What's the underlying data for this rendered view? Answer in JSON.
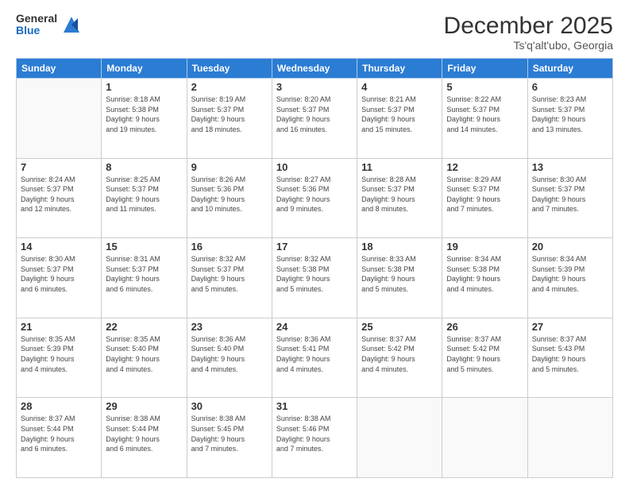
{
  "logo": {
    "general": "General",
    "blue": "Blue"
  },
  "header": {
    "month": "December 2025",
    "location": "Ts'q'alt'ubo, Georgia"
  },
  "days_of_week": [
    "Sunday",
    "Monday",
    "Tuesday",
    "Wednesday",
    "Thursday",
    "Friday",
    "Saturday"
  ],
  "weeks": [
    [
      {
        "day": "",
        "info": ""
      },
      {
        "day": "1",
        "info": "Sunrise: 8:18 AM\nSunset: 5:38 PM\nDaylight: 9 hours\nand 19 minutes."
      },
      {
        "day": "2",
        "info": "Sunrise: 8:19 AM\nSunset: 5:37 PM\nDaylight: 9 hours\nand 18 minutes."
      },
      {
        "day": "3",
        "info": "Sunrise: 8:20 AM\nSunset: 5:37 PM\nDaylight: 9 hours\nand 16 minutes."
      },
      {
        "day": "4",
        "info": "Sunrise: 8:21 AM\nSunset: 5:37 PM\nDaylight: 9 hours\nand 15 minutes."
      },
      {
        "day": "5",
        "info": "Sunrise: 8:22 AM\nSunset: 5:37 PM\nDaylight: 9 hours\nand 14 minutes."
      },
      {
        "day": "6",
        "info": "Sunrise: 8:23 AM\nSunset: 5:37 PM\nDaylight: 9 hours\nand 13 minutes."
      }
    ],
    [
      {
        "day": "7",
        "info": "Sunrise: 8:24 AM\nSunset: 5:37 PM\nDaylight: 9 hours\nand 12 minutes."
      },
      {
        "day": "8",
        "info": "Sunrise: 8:25 AM\nSunset: 5:37 PM\nDaylight: 9 hours\nand 11 minutes."
      },
      {
        "day": "9",
        "info": "Sunrise: 8:26 AM\nSunset: 5:36 PM\nDaylight: 9 hours\nand 10 minutes."
      },
      {
        "day": "10",
        "info": "Sunrise: 8:27 AM\nSunset: 5:36 PM\nDaylight: 9 hours\nand 9 minutes."
      },
      {
        "day": "11",
        "info": "Sunrise: 8:28 AM\nSunset: 5:37 PM\nDaylight: 9 hours\nand 8 minutes."
      },
      {
        "day": "12",
        "info": "Sunrise: 8:29 AM\nSunset: 5:37 PM\nDaylight: 9 hours\nand 7 minutes."
      },
      {
        "day": "13",
        "info": "Sunrise: 8:30 AM\nSunset: 5:37 PM\nDaylight: 9 hours\nand 7 minutes."
      }
    ],
    [
      {
        "day": "14",
        "info": "Sunrise: 8:30 AM\nSunset: 5:37 PM\nDaylight: 9 hours\nand 6 minutes."
      },
      {
        "day": "15",
        "info": "Sunrise: 8:31 AM\nSunset: 5:37 PM\nDaylight: 9 hours\nand 6 minutes."
      },
      {
        "day": "16",
        "info": "Sunrise: 8:32 AM\nSunset: 5:37 PM\nDaylight: 9 hours\nand 5 minutes."
      },
      {
        "day": "17",
        "info": "Sunrise: 8:32 AM\nSunset: 5:38 PM\nDaylight: 9 hours\nand 5 minutes."
      },
      {
        "day": "18",
        "info": "Sunrise: 8:33 AM\nSunset: 5:38 PM\nDaylight: 9 hours\nand 5 minutes."
      },
      {
        "day": "19",
        "info": "Sunrise: 8:34 AM\nSunset: 5:38 PM\nDaylight: 9 hours\nand 4 minutes."
      },
      {
        "day": "20",
        "info": "Sunrise: 8:34 AM\nSunset: 5:39 PM\nDaylight: 9 hours\nand 4 minutes."
      }
    ],
    [
      {
        "day": "21",
        "info": "Sunrise: 8:35 AM\nSunset: 5:39 PM\nDaylight: 9 hours\nand 4 minutes."
      },
      {
        "day": "22",
        "info": "Sunrise: 8:35 AM\nSunset: 5:40 PM\nDaylight: 9 hours\nand 4 minutes."
      },
      {
        "day": "23",
        "info": "Sunrise: 8:36 AM\nSunset: 5:40 PM\nDaylight: 9 hours\nand 4 minutes."
      },
      {
        "day": "24",
        "info": "Sunrise: 8:36 AM\nSunset: 5:41 PM\nDaylight: 9 hours\nand 4 minutes."
      },
      {
        "day": "25",
        "info": "Sunrise: 8:37 AM\nSunset: 5:42 PM\nDaylight: 9 hours\nand 4 minutes."
      },
      {
        "day": "26",
        "info": "Sunrise: 8:37 AM\nSunset: 5:42 PM\nDaylight: 9 hours\nand 5 minutes."
      },
      {
        "day": "27",
        "info": "Sunrise: 8:37 AM\nSunset: 5:43 PM\nDaylight: 9 hours\nand 5 minutes."
      }
    ],
    [
      {
        "day": "28",
        "info": "Sunrise: 8:37 AM\nSunset: 5:44 PM\nDaylight: 9 hours\nand 6 minutes."
      },
      {
        "day": "29",
        "info": "Sunrise: 8:38 AM\nSunset: 5:44 PM\nDaylight: 9 hours\nand 6 minutes."
      },
      {
        "day": "30",
        "info": "Sunrise: 8:38 AM\nSunset: 5:45 PM\nDaylight: 9 hours\nand 7 minutes."
      },
      {
        "day": "31",
        "info": "Sunrise: 8:38 AM\nSunset: 5:46 PM\nDaylight: 9 hours\nand 7 minutes."
      },
      {
        "day": "",
        "info": ""
      },
      {
        "day": "",
        "info": ""
      },
      {
        "day": "",
        "info": ""
      }
    ]
  ]
}
